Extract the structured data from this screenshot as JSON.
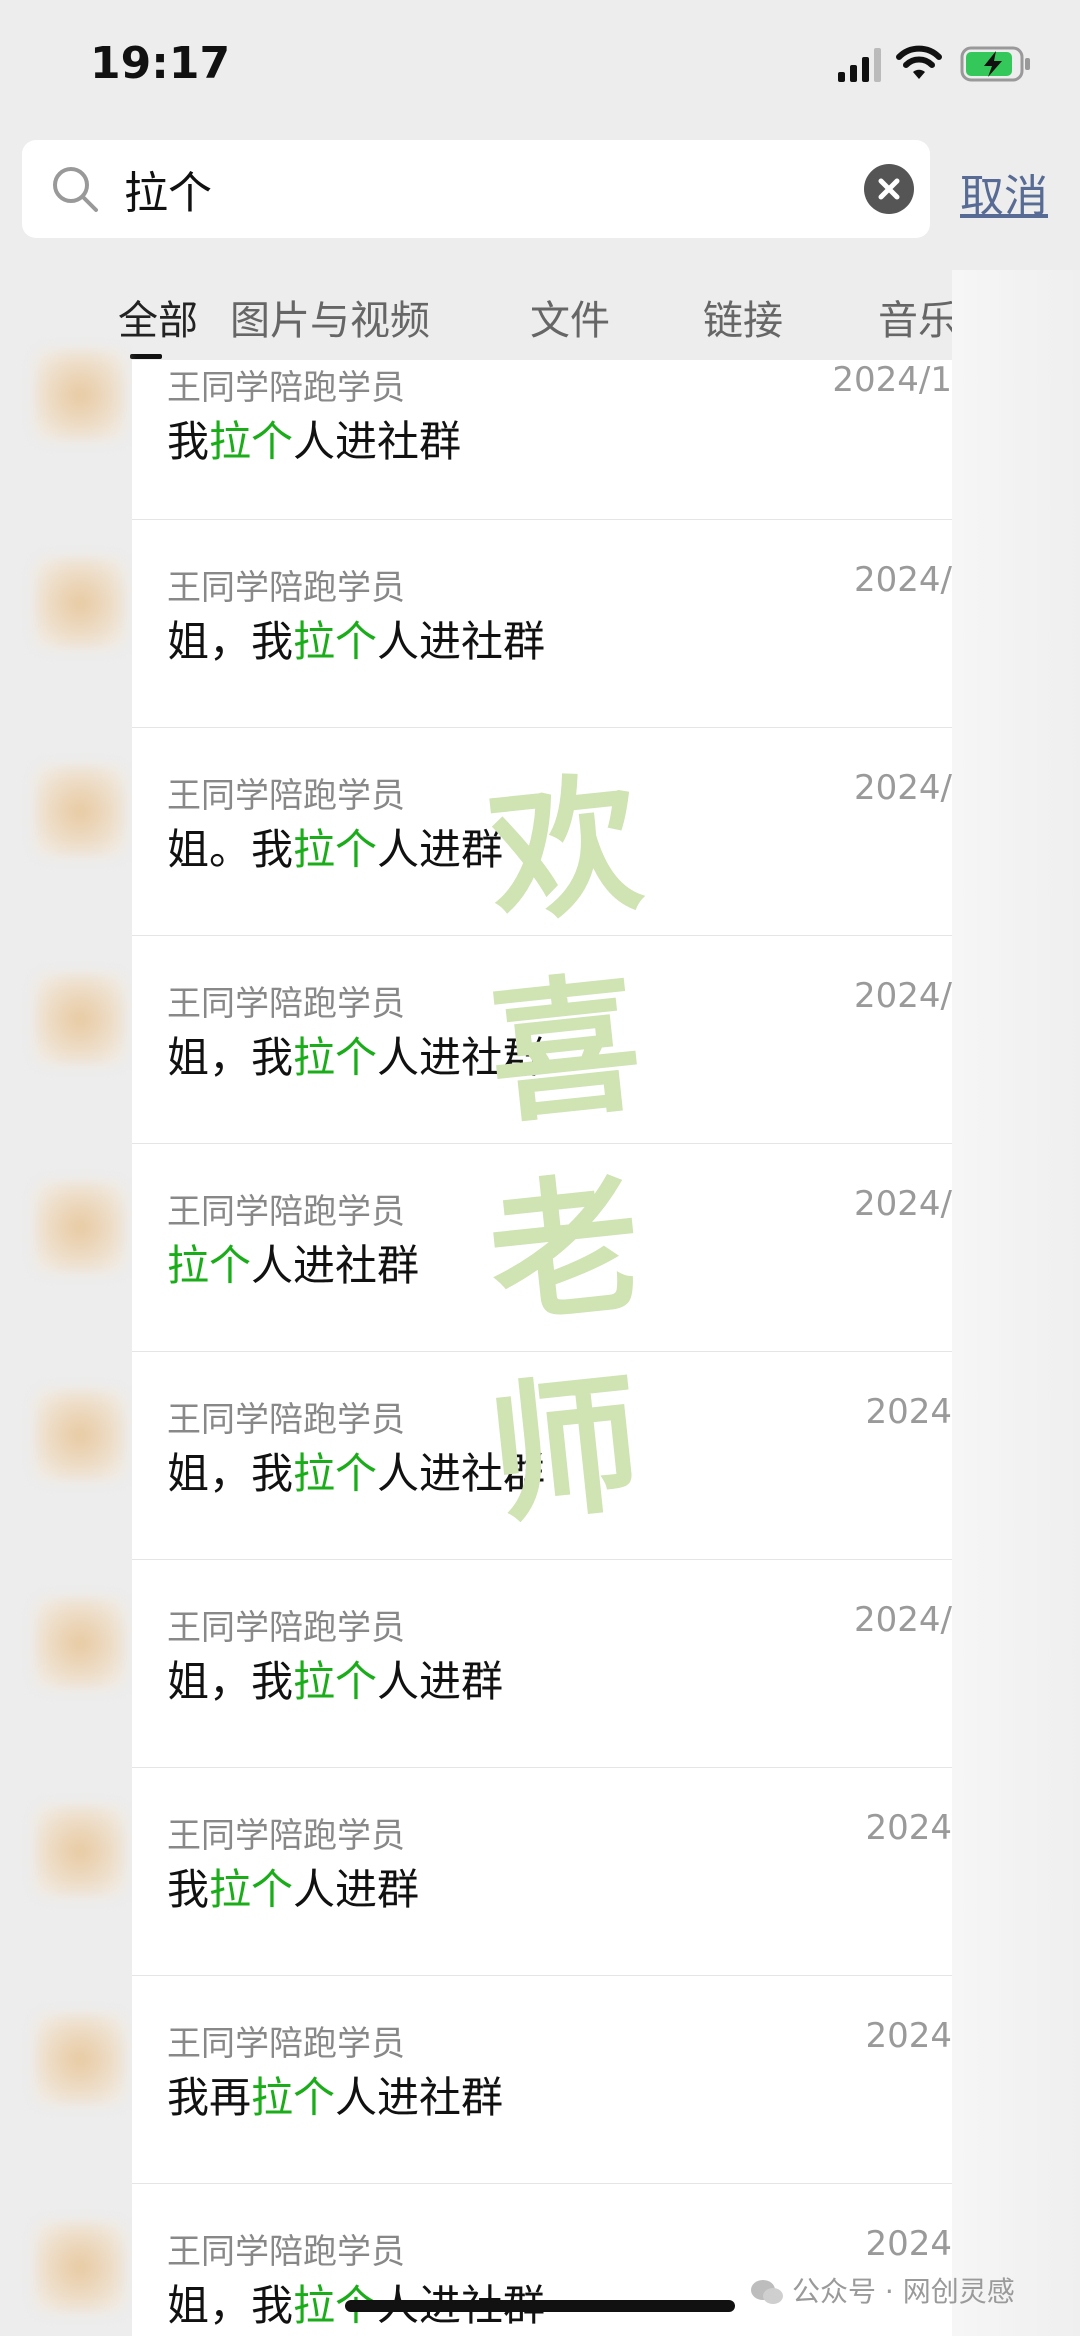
{
  "status_bar": {
    "time": "19:17"
  },
  "search": {
    "query": "拉个",
    "cancel_label": "取消"
  },
  "tabs": [
    {
      "label": "全部"
    },
    {
      "label": "图片与视频"
    },
    {
      "label": "文件"
    },
    {
      "label": "链接"
    },
    {
      "label": "音乐"
    }
  ],
  "results": [
    {
      "sender": "王同学陪跑学员",
      "date": "2024/1",
      "pre": "我",
      "hl": "拉个",
      "post": "人进社群"
    },
    {
      "sender": "王同学陪跑学员",
      "date": "2024/",
      "pre": "姐，我",
      "hl": "拉个",
      "post": "人进社群"
    },
    {
      "sender": "王同学陪跑学员",
      "date": "2024/",
      "pre": "姐。我",
      "hl": "拉个",
      "post": "人进群"
    },
    {
      "sender": "王同学陪跑学员",
      "date": "2024/",
      "pre": "姐，我",
      "hl": "拉个",
      "post": "人进社群"
    },
    {
      "sender": "王同学陪跑学员",
      "date": "2024/",
      "pre": "",
      "hl": "拉个",
      "post": "人进社群"
    },
    {
      "sender": "王同学陪跑学员",
      "date": "2024",
      "pre": "姐，我",
      "hl": "拉个",
      "post": "人进社群"
    },
    {
      "sender": "王同学陪跑学员",
      "date": "2024/",
      "pre": "姐，我",
      "hl": "拉个",
      "post": "人进群"
    },
    {
      "sender": "王同学陪跑学员",
      "date": "2024",
      "pre": "我",
      "hl": "拉个",
      "post": "人进群"
    },
    {
      "sender": "王同学陪跑学员",
      "date": "2024",
      "pre": "我再",
      "hl": "拉个",
      "post": "人进社群"
    },
    {
      "sender": "王同学陪跑学员",
      "date": "2024",
      "pre": "姐，我",
      "hl": "拉个",
      "post": "人进社群"
    }
  ],
  "watermark": {
    "chars": [
      "欢",
      "喜",
      "老",
      "师"
    ]
  },
  "footer": {
    "text": "公众号 · 网创灵感"
  },
  "colors": {
    "highlight": "#1aad19",
    "cancel": "#576b95",
    "background": "#ededed"
  }
}
